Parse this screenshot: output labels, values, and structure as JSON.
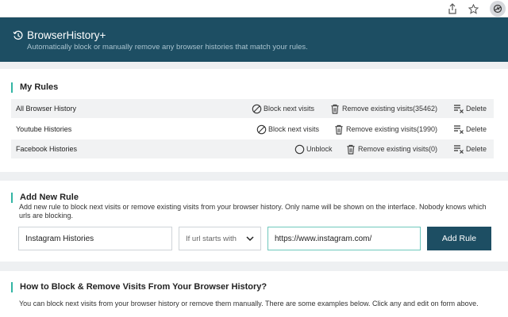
{
  "app": {
    "title": "BrowserHistory+",
    "subtitle": "Automatically block or manually remove any browser histories that match your rules.",
    "accent": "#1d4e63",
    "highlight": "#33b5a4"
  },
  "rules_section": {
    "title": "My Rules",
    "rows": [
      {
        "name": "All Browser History",
        "block_label": "Block next visits",
        "block_icon": "block-icon",
        "remove_label": "Remove existing visits(35462)",
        "delete_label": "Delete"
      },
      {
        "name": "Youtube Histories",
        "block_label": "Block next visits",
        "block_icon": "block-icon",
        "remove_label": "Remove existing visits(1990)",
        "delete_label": "Delete"
      },
      {
        "name": "Facebook Histories",
        "block_label": "Unblock",
        "block_icon": "unblock-icon",
        "remove_label": "Remove existing visits(0)",
        "delete_label": "Delete"
      }
    ]
  },
  "add_section": {
    "title": "Add New Rule",
    "description": "Add new rule to block next visits or remove existing visits from your browser history. Only name will be shown on the interface. Nobody knows which urls are blocking.",
    "name_value": "Instagram Histories",
    "condition_value": "If url starts with",
    "url_value": "https://www.instagram.com/",
    "button_label": "Add Rule"
  },
  "howto_section": {
    "title": "How to Block & Remove Visits From Your Browser History?",
    "text": "You can block next visits from your browser history or remove them manually. There are some examples below. Click any and edit on form above."
  }
}
